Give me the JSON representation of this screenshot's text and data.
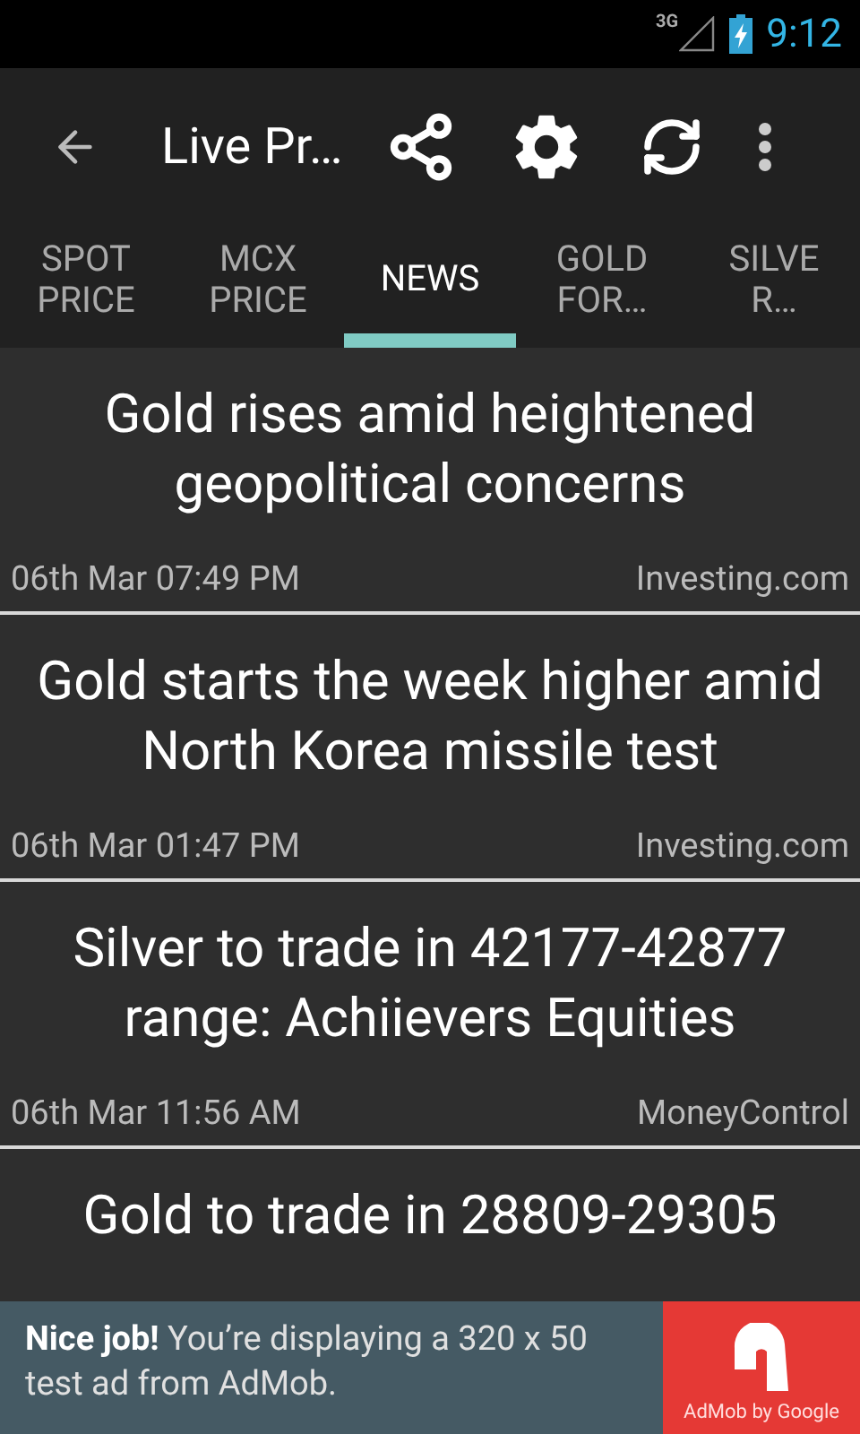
{
  "status_bar": {
    "network": "3G",
    "time": "9:12"
  },
  "action_bar": {
    "title": "Live Pr…"
  },
  "tabs": [
    {
      "label": "SPOT\nPRICE",
      "selected": false
    },
    {
      "label": "MCX\nPRICE",
      "selected": false
    },
    {
      "label": "NEWS",
      "selected": true
    },
    {
      "label": "GOLD\nFOR…",
      "selected": false
    },
    {
      "label": "SILVE\nR…",
      "selected": false
    }
  ],
  "news": [
    {
      "title": "Gold rises amid heightened geopolitical concerns",
      "date": "06th Mar 07:49 PM",
      "source": "Investing.com"
    },
    {
      "title": "Gold starts the week higher amid North Korea missile test",
      "date": "06th Mar 01:47 PM",
      "source": "Investing.com"
    },
    {
      "title": "Silver to trade in 42177-42877 range: Achiievers Equities",
      "date": "06th Mar 11:56 AM",
      "source": "MoneyControl"
    },
    {
      "title": "Gold to trade in 28809-29305"
    }
  ],
  "ad": {
    "text": "**Nice job!** You’re displaying a 320 x 50 test ad from AdMob.",
    "brand": "AdMob by Google"
  }
}
